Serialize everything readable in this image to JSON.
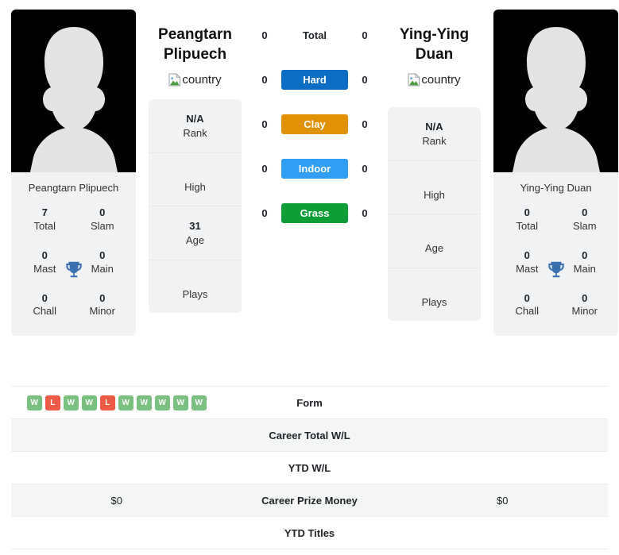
{
  "players": {
    "left": {
      "first_name": "Peangtarn",
      "last_name": "Plipuech",
      "full_name": "Peangtarn Plipuech",
      "flag_alt": "country",
      "info": [
        {
          "value": "N/A",
          "label": "Rank"
        },
        {
          "value": "",
          "label": "High"
        },
        {
          "value": "31",
          "label": "Age"
        },
        {
          "value": "",
          "label": "Plays"
        }
      ],
      "titles": [
        {
          "value": "7",
          "label": "Total"
        },
        {
          "value": "0",
          "label": "Slam"
        },
        {
          "value": "0",
          "label": "Mast"
        },
        {
          "value": "0",
          "label": "Main"
        },
        {
          "value": "0",
          "label": "Chall"
        },
        {
          "value": "0",
          "label": "Minor"
        }
      ],
      "form": [
        "W",
        "L",
        "W",
        "W",
        "L",
        "W",
        "W",
        "W",
        "W",
        "W"
      ],
      "career_total_wl": "",
      "ytd_wl": "",
      "career_prize_money": "$0",
      "ytd_titles": ""
    },
    "right": {
      "first_name": "Ying-Ying",
      "last_name": "Duan",
      "full_name": "Ying-Ying Duan",
      "flag_alt": "country",
      "info": [
        {
          "value": "N/A",
          "label": "Rank"
        },
        {
          "value": "",
          "label": "High"
        },
        {
          "value": "",
          "label": "Age"
        },
        {
          "value": "",
          "label": "Plays"
        }
      ],
      "titles": [
        {
          "value": "0",
          "label": "Total"
        },
        {
          "value": "0",
          "label": "Slam"
        },
        {
          "value": "0",
          "label": "Mast"
        },
        {
          "value": "0",
          "label": "Main"
        },
        {
          "value": "0",
          "label": "Chall"
        },
        {
          "value": "0",
          "label": "Minor"
        }
      ],
      "form": [],
      "career_total_wl": "",
      "ytd_wl": "",
      "career_prize_money": "$0",
      "ytd_titles": ""
    }
  },
  "head_to_head": [
    {
      "label": "Total",
      "left": "0",
      "right": "0",
      "color": ""
    },
    {
      "label": "Hard",
      "left": "0",
      "right": "0",
      "color": "#0b6ec4"
    },
    {
      "label": "Clay",
      "left": "0",
      "right": "0",
      "color": "#e09106"
    },
    {
      "label": "Indoor",
      "left": "0",
      "right": "0",
      "color": "#2f9ef3"
    },
    {
      "label": "Grass",
      "left": "0",
      "right": "0",
      "color": "#0f9d38"
    }
  ],
  "stats_rows": [
    {
      "label": "Form",
      "left": "",
      "right": ""
    },
    {
      "label": "Career Total W/L",
      "left": "",
      "right": ""
    },
    {
      "label": "YTD W/L",
      "left": "",
      "right": ""
    },
    {
      "label": "Career Prize Money",
      "left": "$0",
      "right": "$0"
    },
    {
      "label": "YTD Titles",
      "left": "",
      "right": ""
    }
  ],
  "colors": {
    "win_badge": "#7ac17f",
    "loss_badge": "#ed5a45",
    "card_bg": "#f1f2f3",
    "row_alt_bg": "#f4f5f5"
  }
}
